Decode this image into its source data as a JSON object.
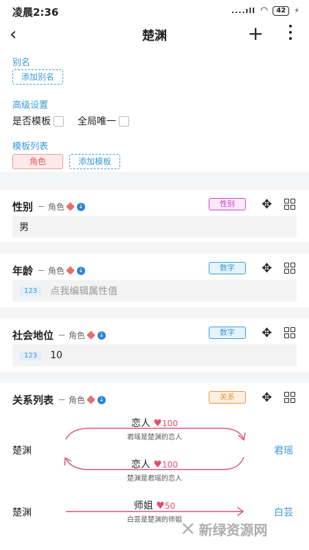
{
  "status": {
    "time": "凌晨2:36",
    "signal": "....ıll",
    "battery": "42"
  },
  "header": {
    "back": "‹",
    "title": "楚渊",
    "plus": "+"
  },
  "alias": {
    "label": "别名",
    "add": "添加别名"
  },
  "advanced": {
    "label": "高级设置",
    "is_template": "是否模板",
    "global_unique": "全局唯一"
  },
  "templates": {
    "label": "模板列表",
    "role_tag": "角色",
    "add": "添加模板"
  },
  "cards": [
    {
      "name": "性别",
      "sub": "－ 角色",
      "type": "性别",
      "value": "男"
    },
    {
      "name": "年龄",
      "sub": "－ 角色",
      "type": "数字",
      "badge": "123",
      "placeholder": "点我编辑属性值"
    },
    {
      "name": "社会地位",
      "sub": "－ 角色",
      "type": "数字",
      "badge": "123",
      "value": "10"
    },
    {
      "name": "关系列表",
      "sub": "－ 角色",
      "type": "关系"
    }
  ],
  "relations": [
    {
      "from": "楚渊",
      "to": "君瑶",
      "top_label": "恋人",
      "score": "100",
      "desc": "君瑶是楚渊的恋人"
    },
    {
      "label": "恋人",
      "score": "100",
      "desc": "楚渊是君瑶的恋人"
    },
    {
      "from": "楚渊",
      "to": "白芸",
      "top_label": "师姐",
      "score": "50",
      "desc": "白芸是楚渊的师姐"
    }
  ],
  "colors": {
    "accent": "#3a9bd5",
    "relation": "#d9557a",
    "gender_tag": "#c445c4",
    "number_tag": "#3a9bd5",
    "relation_tag": "#e8913a"
  },
  "watermark": "新绿资源网"
}
